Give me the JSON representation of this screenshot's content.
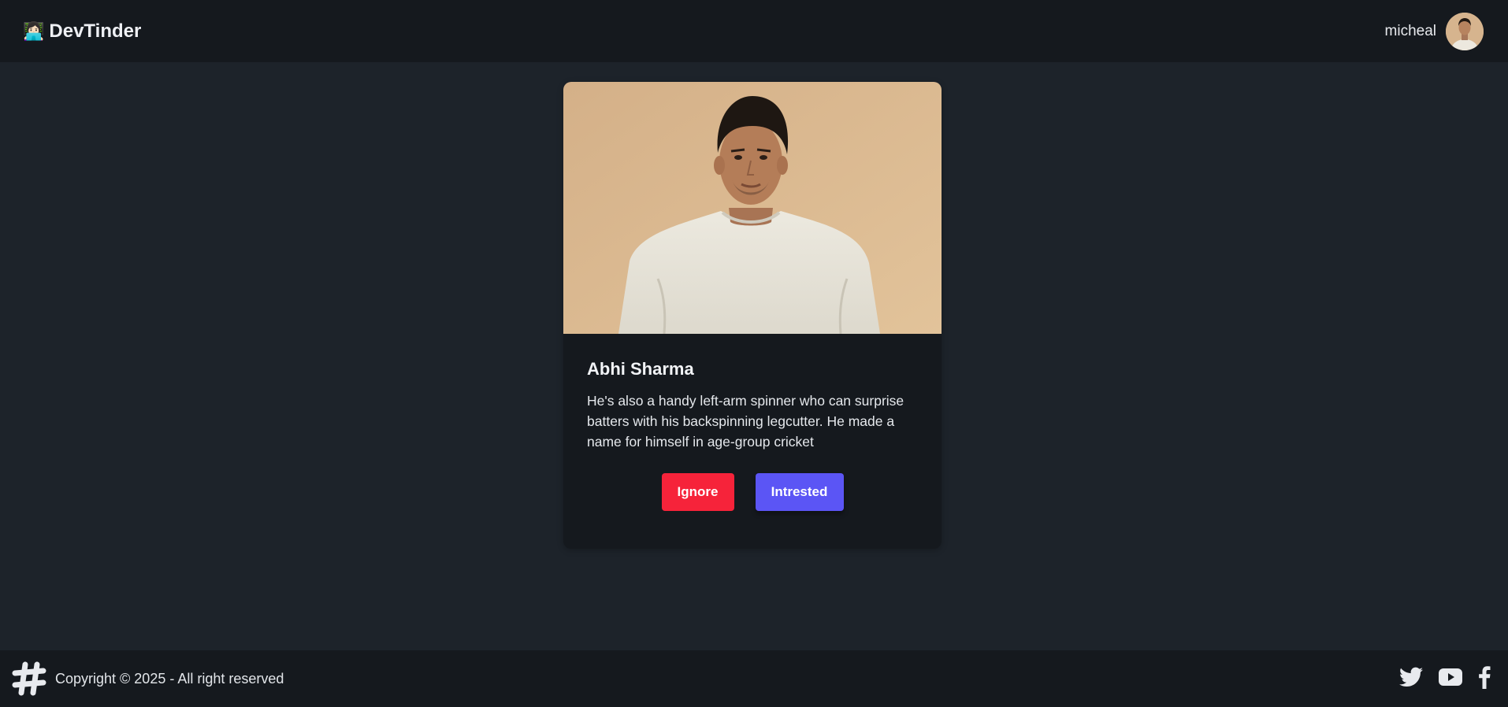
{
  "navbar": {
    "brand_icon": "👩🏻‍💻",
    "brand": "DevTinder",
    "user_name": "micheal",
    "avatar_icon": "user-avatar-photo"
  },
  "card": {
    "photo_icon": "profile-photo",
    "name": "Abhi Sharma",
    "bio": "He's also a handy left-arm spinner who can surprise batters with his backspinning legcutter. He made a name for himself in age-group cricket",
    "ignore_label": "Ignore",
    "interested_label": "Intrested",
    "colors": {
      "ignore": "#f6233a",
      "interested": "#5b55f5"
    }
  },
  "footer": {
    "logo_icon": "hashtag-logo-icon",
    "copyright": "Copyright © 2025 - All right reserved",
    "social_icons": [
      "twitter-icon",
      "youtube-icon",
      "facebook-icon"
    ]
  },
  "colors": {
    "background": "#1d232a",
    "surface": "#15191e"
  }
}
